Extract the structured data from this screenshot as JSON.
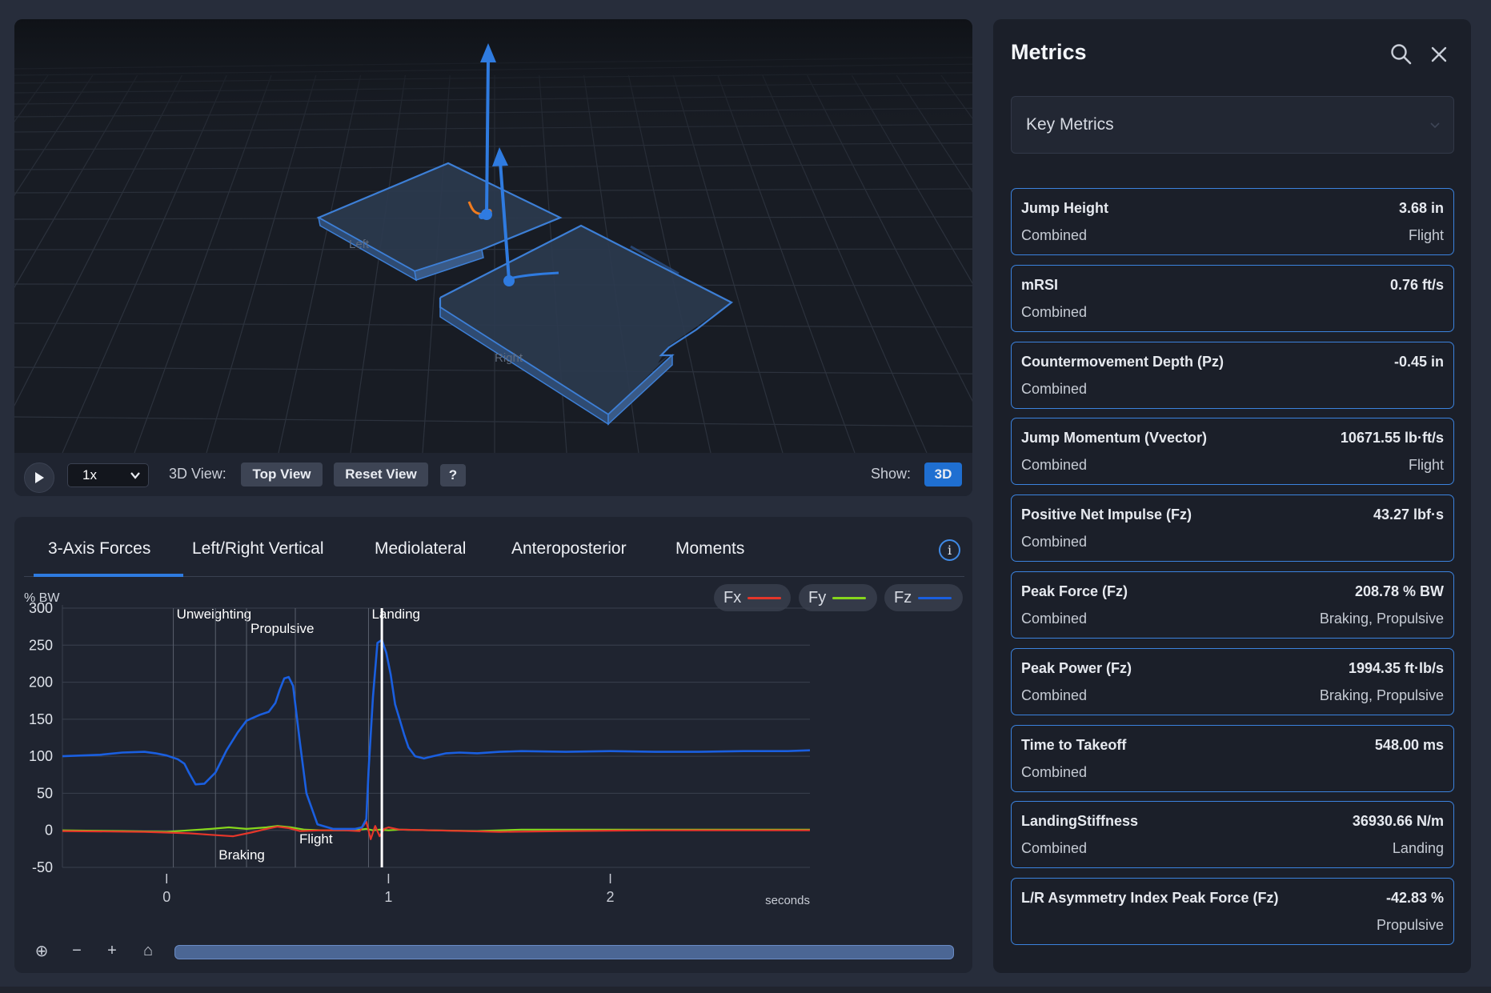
{
  "viewer": {
    "plate_left_label": "Left",
    "plate_right_label": "Right",
    "speed": "1x",
    "view_label": "3D View:",
    "top_view": "Top View",
    "reset_view": "Reset View",
    "help": "?",
    "show_label": "Show:",
    "show_mode": "3D"
  },
  "tabs": [
    {
      "label": "3-Axis Forces",
      "active": true
    },
    {
      "label": "Left/Right Vertical"
    },
    {
      "label": "Mediolateral"
    },
    {
      "label": "Anteroposterior"
    },
    {
      "label": "Moments"
    }
  ],
  "info": "i",
  "legend": [
    {
      "name": "Fx",
      "color": "#e5362a"
    },
    {
      "name": "Fy",
      "color": "#86d61c"
    },
    {
      "name": "Fz",
      "color": "#1a5fe0"
    }
  ],
  "chart_data": {
    "type": "line",
    "ylabel": "% BW",
    "xlabel": "seconds",
    "xlim": [
      -0.47,
      2.9
    ],
    "ylim": [
      -50,
      300
    ],
    "yticks": [
      300,
      250,
      200,
      150,
      100,
      50,
      0,
      -50
    ],
    "xticks": [
      0,
      1,
      2
    ],
    "cursor_x": 0.97,
    "phases": [
      {
        "label": "Unweighting",
        "x": 0.03
      },
      {
        "label": "Braking",
        "x": 0.22
      },
      {
        "label": "Propulsive",
        "x": 0.36
      },
      {
        "label": "Flight",
        "x": 0.58
      },
      {
        "label": "Landing",
        "x": 0.91
      }
    ],
    "series": [
      {
        "name": "Fz",
        "color": "#1a5fe0",
        "x": [
          -0.47,
          -0.3,
          -0.2,
          -0.1,
          -0.05,
          0.0,
          0.05,
          0.08,
          0.1,
          0.13,
          0.17,
          0.22,
          0.27,
          0.32,
          0.36,
          0.42,
          0.46,
          0.49,
          0.51,
          0.53,
          0.55,
          0.57,
          0.58,
          0.6,
          0.63,
          0.68,
          0.75,
          0.85,
          0.88,
          0.9,
          0.91,
          0.93,
          0.95,
          0.97,
          0.99,
          1.01,
          1.03,
          1.05,
          1.07,
          1.09,
          1.12,
          1.16,
          1.2,
          1.26,
          1.32,
          1.4,
          1.5,
          1.6,
          1.8,
          2.0,
          2.2,
          2.4,
          2.6,
          2.8,
          2.9
        ],
        "y": [
          100,
          102,
          105,
          106,
          104,
          101,
          96,
          90,
          78,
          62,
          63,
          78,
          108,
          132,
          148,
          156,
          160,
          172,
          190,
          205,
          207,
          195,
          170,
          120,
          50,
          8,
          2,
          2,
          4,
          15,
          80,
          180,
          253,
          257,
          240,
          210,
          170,
          150,
          130,
          112,
          100,
          97,
          100,
          104,
          105,
          104,
          106,
          107,
          106,
          107,
          106,
          106,
          107,
          107,
          108
        ]
      },
      {
        "name": "Fx",
        "color": "#e5362a",
        "x": [
          -0.47,
          -0.1,
          0.1,
          0.2,
          0.3,
          0.38,
          0.45,
          0.5,
          0.55,
          0.6,
          0.7,
          0.8,
          0.87,
          0.9,
          0.92,
          0.94,
          0.96,
          0.98,
          1.0,
          1.05,
          1.2,
          1.5,
          1.8,
          2.2,
          2.6,
          2.9
        ],
        "y": [
          -1,
          -2,
          -4,
          -6,
          -8,
          -3,
          2,
          5,
          3,
          -1,
          0,
          0,
          -1,
          12,
          -12,
          6,
          -8,
          2,
          4,
          1,
          0,
          -2,
          -1,
          0,
          0,
          0
        ]
      },
      {
        "name": "Fy",
        "color": "#86d61c",
        "x": [
          -0.47,
          -0.2,
          0.0,
          0.1,
          0.2,
          0.28,
          0.36,
          0.45,
          0.5,
          0.56,
          0.62,
          0.7,
          0.85,
          0.9,
          0.93,
          0.96,
          1.0,
          1.05,
          1.2,
          1.4,
          1.6,
          1.8,
          2.0,
          2.2,
          2.6,
          2.9
        ],
        "y": [
          0,
          -1,
          -2,
          0,
          2,
          4,
          2,
          4,
          6,
          4,
          1,
          0,
          0,
          2,
          0,
          1,
          0,
          1,
          0,
          -1,
          1,
          1,
          1,
          1,
          1,
          1
        ]
      }
    ]
  },
  "toolbar": {
    "zoom_icon": "⊕",
    "minus": "−",
    "plus": "+",
    "home_icon": "⌂"
  },
  "metrics": {
    "title": "Metrics",
    "dropdown": "Key Metrics",
    "cards": [
      {
        "name": "Jump Height",
        "value": "3.68 in",
        "sub": "Combined",
        "phase": "Flight"
      },
      {
        "name": "mRSI",
        "value": "0.76 ft/s",
        "sub": "Combined",
        "phase": ""
      },
      {
        "name": "Countermovement Depth (Pz)",
        "value": "-0.45 in",
        "sub": "Combined",
        "phase": ""
      },
      {
        "name": "Jump Momentum (Vvector)",
        "value": "10671.55 lb·ft/s",
        "sub": "Combined",
        "phase": "Flight"
      },
      {
        "name": "Positive Net Impulse (Fz)",
        "value": "43.27 lbf·s",
        "sub": "Combined",
        "phase": ""
      },
      {
        "name": "Peak Force (Fz)",
        "value": "208.78 % BW",
        "sub": "Combined",
        "phase": "Braking, Propulsive"
      },
      {
        "name": "Peak Power (Fz)",
        "value": "1994.35 ft·lb/s",
        "sub": "Combined",
        "phase": "Braking, Propulsive"
      },
      {
        "name": "Time to Takeoff",
        "value": "548.00 ms",
        "sub": "Combined",
        "phase": ""
      },
      {
        "name": "LandingStiffness",
        "value": "36930.66 N/m",
        "sub": "Combined",
        "phase": "Landing"
      },
      {
        "name": "L/R Asymmetry Index Peak Force (Fz)",
        "value": "-42.83 %",
        "sub": "",
        "phase": "Propulsive"
      }
    ]
  }
}
